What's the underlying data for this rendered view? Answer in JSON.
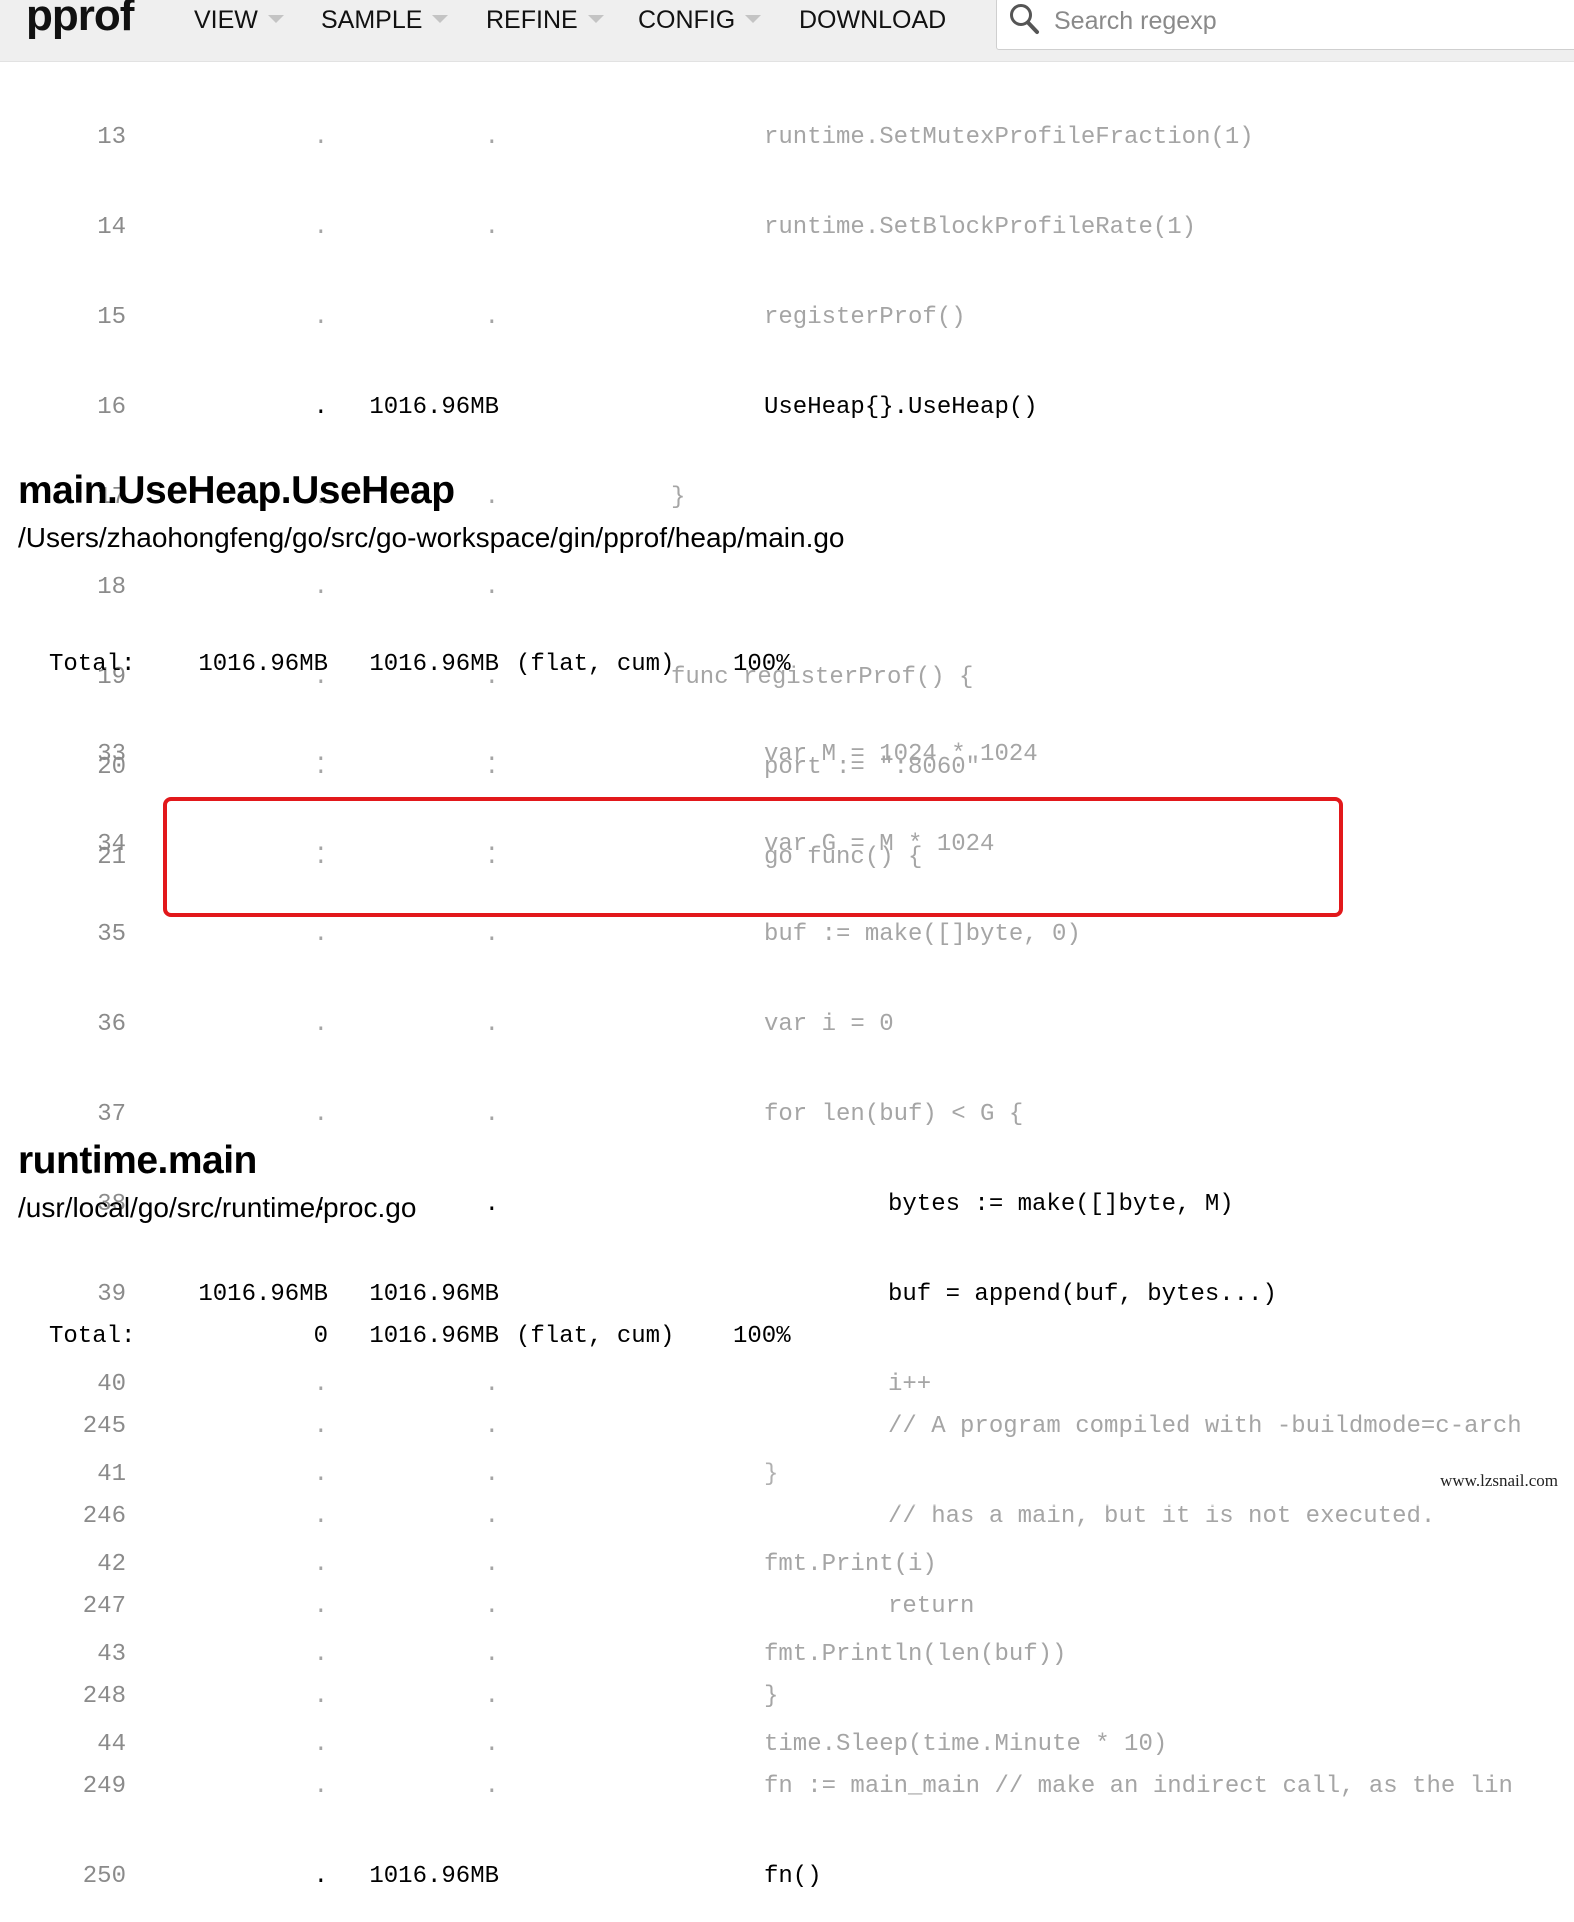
{
  "header": {
    "logo": "pprof",
    "menus": [
      {
        "label": "VIEW"
      },
      {
        "label": "SAMPLE"
      },
      {
        "label": "REFINE"
      },
      {
        "label": "CONFIG"
      },
      {
        "label": "DOWNLOAD"
      }
    ],
    "search": {
      "placeholder": "Search regexp",
      "value": ""
    }
  },
  "sections": [
    {
      "lines": [
        {
          "num": "13",
          "flat": ".",
          "cum": ".",
          "code": "runtime.SetMutexProfileFraction(1)",
          "hot": false
        },
        {
          "num": "14",
          "flat": ".",
          "cum": ".",
          "code": "runtime.SetBlockProfileRate(1)",
          "hot": false
        },
        {
          "num": "15",
          "flat": ".",
          "cum": ".",
          "code": "registerProf()",
          "hot": false
        },
        {
          "num": "16",
          "flat": ".",
          "cum": "1016.96MB",
          "code": "UseHeap{}.UseHeap()",
          "hot": true
        },
        {
          "num": "17",
          "flat": ".",
          "cum": ".",
          "code": "}",
          "hot": false
        },
        {
          "num": "18",
          "flat": ".",
          "cum": ".",
          "code": "",
          "hot": false
        },
        {
          "num": "19",
          "flat": ".",
          "cum": ".",
          "code": "func registerProf() {",
          "hot": false
        },
        {
          "num": "20",
          "flat": ".",
          "cum": ".",
          "code": "port := \":8060\"",
          "hot": false
        },
        {
          "num": "21",
          "flat": ".",
          "cum": ".",
          "code": "go func() {",
          "hot": false
        }
      ]
    },
    {
      "title": "main.UseHeap.UseHeap",
      "file": "/Users/zhaohongfeng/go/src/go-workspace/gin/pprof/heap/main.go",
      "total": {
        "label": "Total:",
        "flat": "1016.96MB",
        "cum": "1016.96MB",
        "kind": "(flat, cum)",
        "pct": "100%"
      },
      "lines": [
        {
          "num": "33",
          "flat": ".",
          "cum": ".",
          "code": "var M = 1024 * 1024",
          "hot": false
        },
        {
          "num": "34",
          "flat": ".",
          "cum": ".",
          "code": "var G = M * 1024",
          "hot": false
        },
        {
          "num": "35",
          "flat": ".",
          "cum": ".",
          "code": "buf := make([]byte, 0)",
          "hot": false
        },
        {
          "num": "36",
          "flat": ".",
          "cum": ".",
          "code": "var i = 0",
          "hot": false
        },
        {
          "num": "37",
          "flat": ".",
          "cum": ".",
          "code": "for len(buf) < G {",
          "hot": false
        },
        {
          "num": "38",
          "flat": ".",
          "cum": ".",
          "code": "bytes := make([]byte, M)",
          "hot": true
        },
        {
          "num": "39",
          "flat": "1016.96MB",
          "cum": "1016.96MB",
          "code": "buf = append(buf, bytes...)",
          "hot": true
        },
        {
          "num": "40",
          "flat": ".",
          "cum": ".",
          "code": "i++",
          "hot": false
        },
        {
          "num": "41",
          "flat": ".",
          "cum": ".",
          "code": "}",
          "hot": false
        },
        {
          "num": "42",
          "flat": ".",
          "cum": ".",
          "code": "fmt.Print(i)",
          "hot": false
        },
        {
          "num": "43",
          "flat": ".",
          "cum": ".",
          "code": "fmt.Println(len(buf))",
          "hot": false
        },
        {
          "num": "44",
          "flat": ".",
          "cum": ".",
          "code": "time.Sleep(time.Minute * 10)",
          "hot": false
        }
      ]
    },
    {
      "title": "runtime.main",
      "file": "/usr/local/go/src/runtime/proc.go",
      "total": {
        "label": "Total:",
        "flat": "0",
        "cum": "1016.96MB",
        "kind": "(flat, cum)",
        "pct": "100%"
      },
      "lines": [
        {
          "num": "245",
          "flat": ".",
          "cum": ".",
          "code": "// A program compiled with -buildmode=c-arch",
          "hot": false
        },
        {
          "num": "246",
          "flat": ".",
          "cum": ".",
          "code": "// has a main, but it is not executed.",
          "hot": false
        },
        {
          "num": "247",
          "flat": ".",
          "cum": ".",
          "code": "return",
          "hot": false
        },
        {
          "num": "248",
          "flat": ".",
          "cum": ".",
          "code": "}",
          "hot": false
        },
        {
          "num": "249",
          "flat": ".",
          "cum": ".",
          "code": "fn := main_main // make an indirect call, as the lin",
          "hot": false
        },
        {
          "num": "250",
          "flat": ".",
          "cum": "1016.96MB",
          "code": "fn()",
          "hot": true
        }
      ]
    }
  ],
  "watermark": "www.lzsnail.com",
  "colors": {
    "highlight_border": "#e2181b",
    "hot_text": "#000000",
    "cold_text": "#a5a5a5"
  }
}
